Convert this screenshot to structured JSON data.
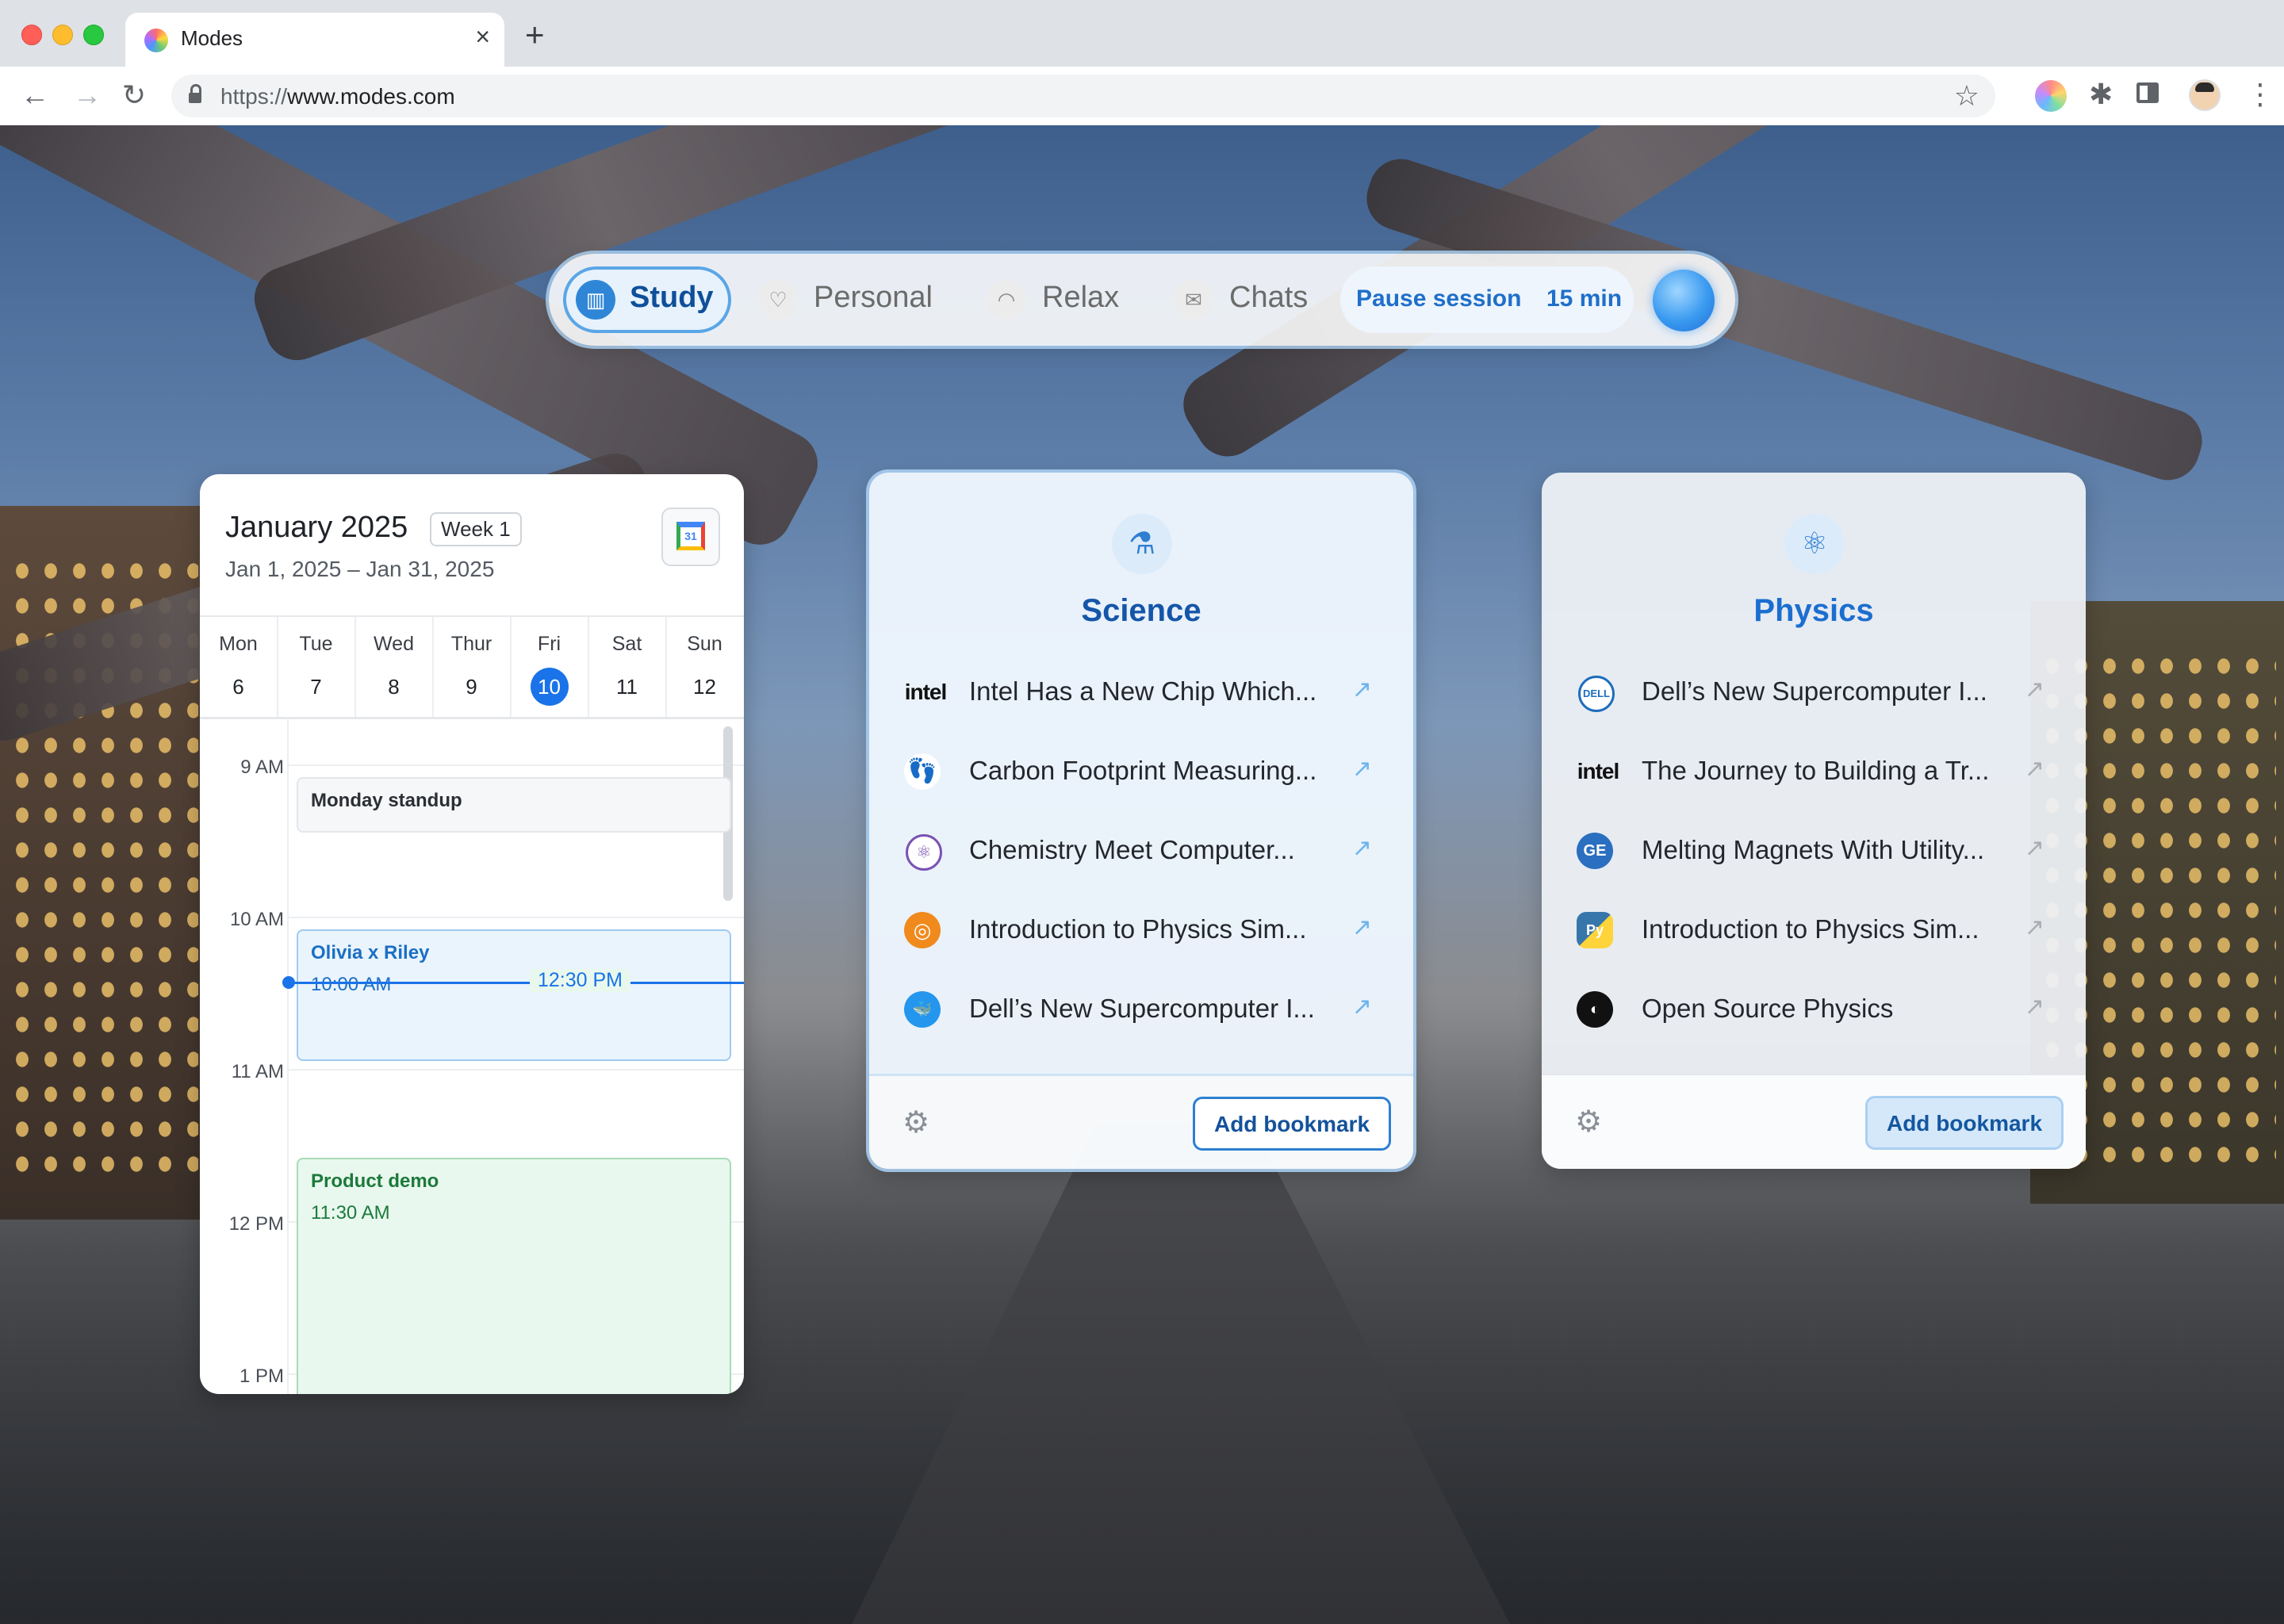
{
  "browser": {
    "tab_title": "Modes",
    "tab_close": "×",
    "new_tab": "+",
    "url_scheme": "https://",
    "url_host": "www.modes.com",
    "nav": {
      "back": "←",
      "forward": "→",
      "reload": "↻"
    },
    "star": "☆",
    "menu": "⋮",
    "puzzle": "✱"
  },
  "modes": {
    "items": [
      {
        "label": "Study",
        "icon": "book-icon",
        "glyph": "▥",
        "active": true
      },
      {
        "label": "Personal",
        "icon": "heart-icon",
        "glyph": "♡",
        "active": false
      },
      {
        "label": "Relax",
        "icon": "headphones-icon",
        "glyph": "◠",
        "active": false
      },
      {
        "label": "Chats",
        "icon": "mail-icon",
        "glyph": "✉",
        "active": false
      }
    ],
    "pause_label": "Pause session",
    "timer": "15 min"
  },
  "calendar": {
    "month": "January 2025",
    "week": "Week 1",
    "range": "Jan 1, 2025 – Jan 31, 2025",
    "gcal_day": "31",
    "days": [
      {
        "name": "Mon",
        "num": "6"
      },
      {
        "name": "Tue",
        "num": "7"
      },
      {
        "name": "Wed",
        "num": "8"
      },
      {
        "name": "Thur",
        "num": "9"
      },
      {
        "name": "Fri",
        "num": "10",
        "today": true
      },
      {
        "name": "Sat",
        "num": "11"
      },
      {
        "name": "Sun",
        "num": "12"
      }
    ],
    "hours": [
      "9 AM",
      "10 AM",
      "11 AM",
      "12 PM",
      "1 PM"
    ],
    "events": [
      {
        "title": "Monday standup",
        "time": ""
      },
      {
        "title": "Olivia x Riley",
        "time": "10:00 AM"
      },
      {
        "title": "Product demo",
        "time": "11:30 AM"
      }
    ],
    "now": "12:30 PM"
  },
  "bookmark_groups": [
    {
      "title": "Science",
      "icon": "flask-icon",
      "glyph": "⚗",
      "items": [
        {
          "logo": "intel-logo",
          "logo_text": "intel",
          "text": "Intel Has a New Chip Which..."
        },
        {
          "logo": "footprint-logo",
          "logo_text": "👣",
          "text": "Carbon Footprint Measuring..."
        },
        {
          "logo": "atom-logo",
          "logo_text": "⚛",
          "text": "Chemistry Meet Computer..."
        },
        {
          "logo": "orange-logo",
          "logo_text": "◎",
          "text": "Introduction to Physics Sim..."
        },
        {
          "logo": "docker-logo",
          "logo_text": "🐳",
          "text": "Dell’s New Supercomputer I..."
        }
      ],
      "add_label": "Add bookmark"
    },
    {
      "title": "Physics",
      "icon": "atom-icon",
      "glyph": "⚛",
      "items": [
        {
          "logo": "dell-logo",
          "logo_text": "DELL",
          "text": "Dell’s New Supercomputer I..."
        },
        {
          "logo": "intel-logo",
          "logo_text": "intel",
          "text": "The Journey to Building a Tr..."
        },
        {
          "logo": "ge-logo",
          "logo_text": "GE",
          "text": "Melting Magnets With Utility..."
        },
        {
          "logo": "python-logo",
          "logo_text": "Py",
          "text": "Introduction to Physics Sim..."
        },
        {
          "logo": "github-logo",
          "logo_text": "◐",
          "text": "Open Source Physics"
        }
      ],
      "add_label": "Add bookmark"
    }
  ],
  "arrow_glyph": "↗",
  "gear_glyph": "⚙"
}
